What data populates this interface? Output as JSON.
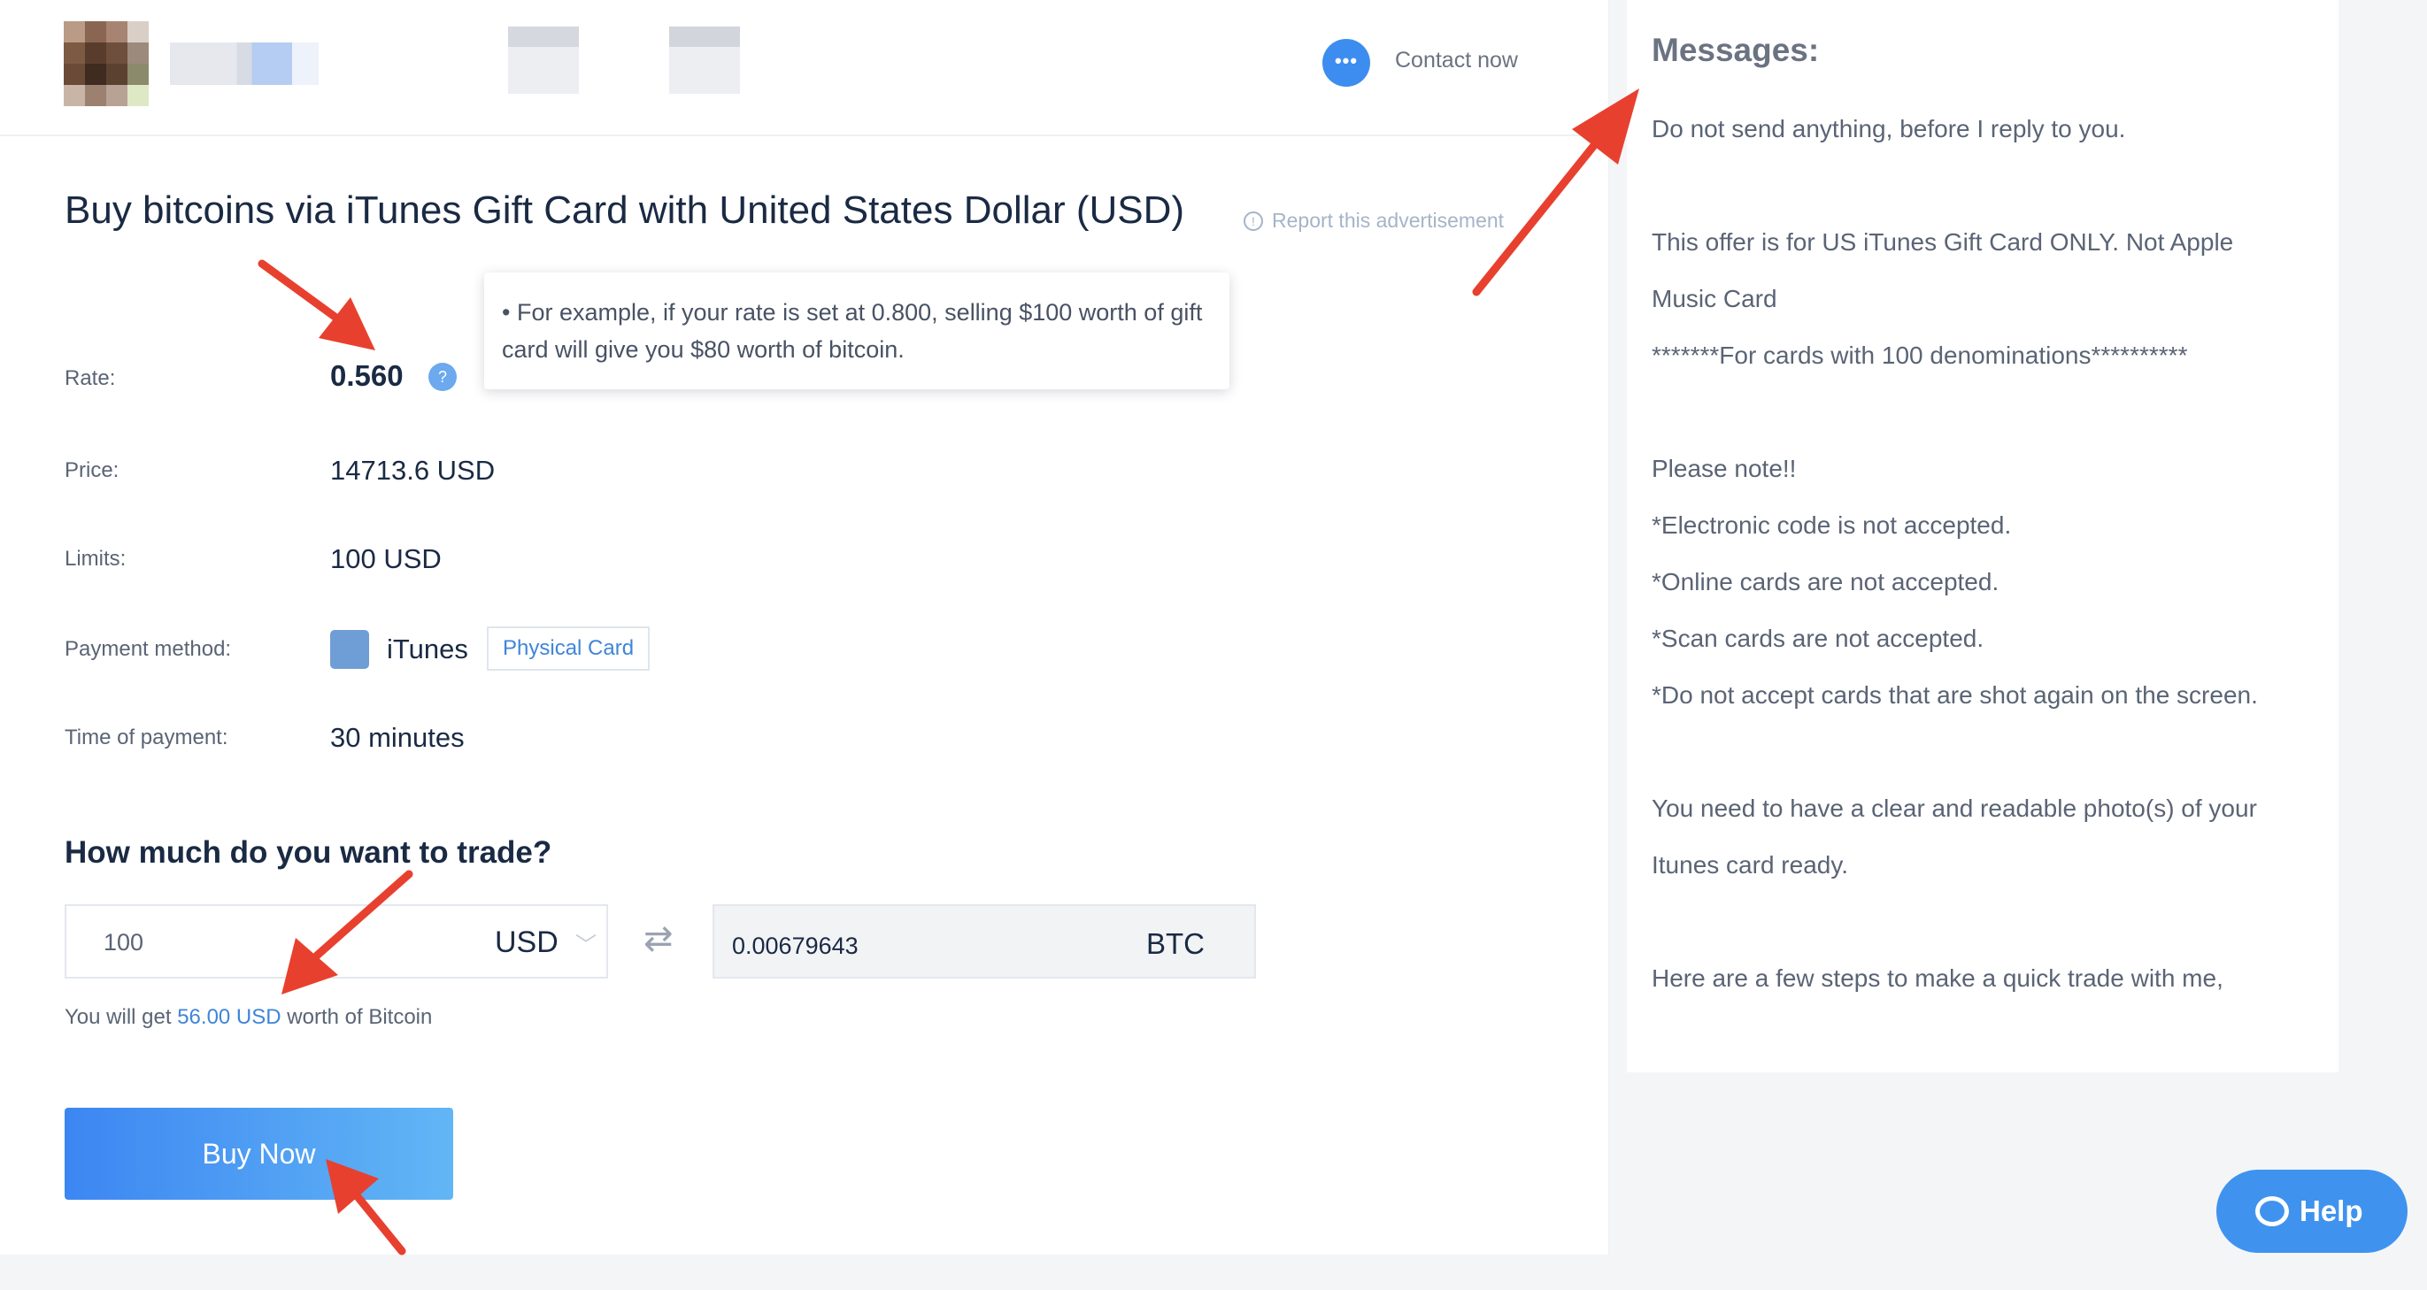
{
  "header": {
    "contact_icon": "chat-dots-icon",
    "contact_label": "Contact now"
  },
  "title": "Buy bitcoins via iTunes Gift Card with United States Dollar (USD)",
  "report_label": "Report this advertisement",
  "tooltip": "• For example, if your rate is set at 0.800, selling $100 worth of gift card will give you $80 worth of bitcoin.",
  "details": {
    "rate_label": "Rate:",
    "rate_value": "0.560",
    "price_label": "Price:",
    "price_value": "14713.6 USD",
    "limits_label": "Limits:",
    "limits_value": "100 USD",
    "payment_label": "Payment method:",
    "payment_value": "iTunes",
    "payment_tag": "Physical Card",
    "time_label": "Time of payment:",
    "time_value": "30 minutes"
  },
  "trade": {
    "question": "How much do you want to trade?",
    "amount": "100",
    "amount_currency": "USD",
    "output": "0.00679643",
    "output_currency": "BTC",
    "note_prefix": "You will get ",
    "note_amount": "56.00 USD",
    "note_suffix": " worth of Bitcoin",
    "buy_label": "Buy Now"
  },
  "messages": {
    "title": "Messages:",
    "lines": [
      "Do not send anything, before I reply to you.",
      "",
      "This offer is for US iTunes Gift Card ONLY. Not Apple",
      "Music Card",
      "*******For cards with 100 denominations**********",
      "",
      "Please note!!",
      "*Electronic code is not accepted.",
      "*Online cards are not accepted.",
      "*Scan cards are not accepted.",
      "*Do not accept cards that are shot again on the screen.",
      "",
      "You need to have a clear and readable photo(s) of your",
      "Itunes card ready.",
      "",
      "Here are a few steps to make a quick trade with me,"
    ]
  },
  "help_label": "Help",
  "colors": {
    "accent": "#3f86d8",
    "annotation_arrow": "#e8402f"
  }
}
